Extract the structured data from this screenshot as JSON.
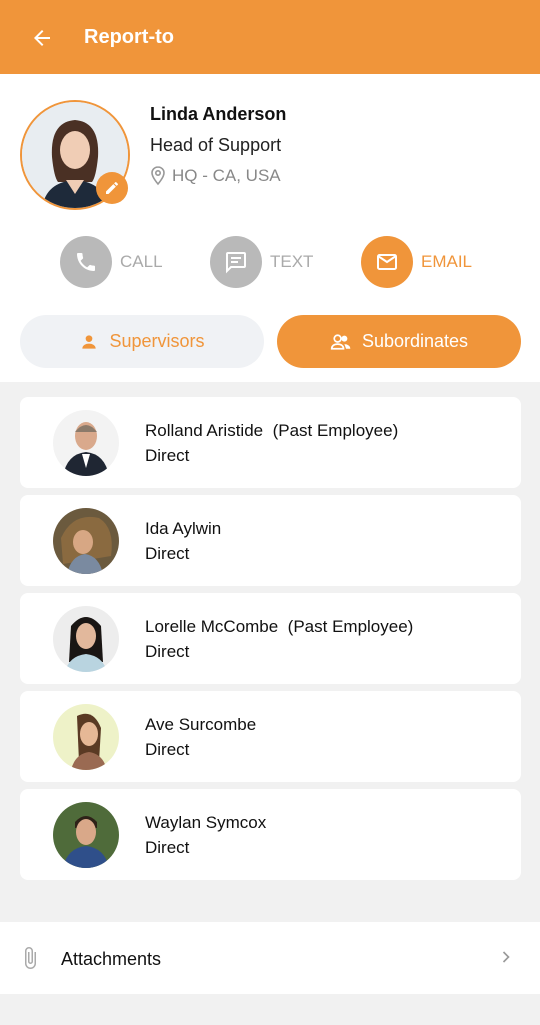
{
  "header": {
    "title": "Report-to"
  },
  "profile": {
    "name": "Linda Anderson",
    "role": "Head of Support",
    "location": "HQ - CA, USA"
  },
  "actions": [
    {
      "label": "CALL",
      "icon": "phone-icon",
      "active": false
    },
    {
      "label": "TEXT",
      "icon": "message-icon",
      "active": false
    },
    {
      "label": "EMAIL",
      "icon": "mail-icon",
      "active": true
    }
  ],
  "tabs": [
    {
      "label": "Supervisors",
      "icon": "person-icon",
      "selected": false
    },
    {
      "label": "Subordinates",
      "icon": "people-icon",
      "selected": true
    }
  ],
  "subordinates": [
    {
      "name": "Rolland Aristide  (Past Employee)",
      "relation": "Direct"
    },
    {
      "name": "Ida Aylwin",
      "relation": "Direct"
    },
    {
      "name": "Lorelle McCombe  (Past Employee)",
      "relation": "Direct"
    },
    {
      "name": "Ave Surcombe",
      "relation": "Direct"
    },
    {
      "name": "Waylan Symcox",
      "relation": "Direct"
    }
  ],
  "attachments": {
    "label": "Attachments"
  },
  "colors": {
    "accent": "#F0953A",
    "inactive": "#b9b9b9"
  }
}
